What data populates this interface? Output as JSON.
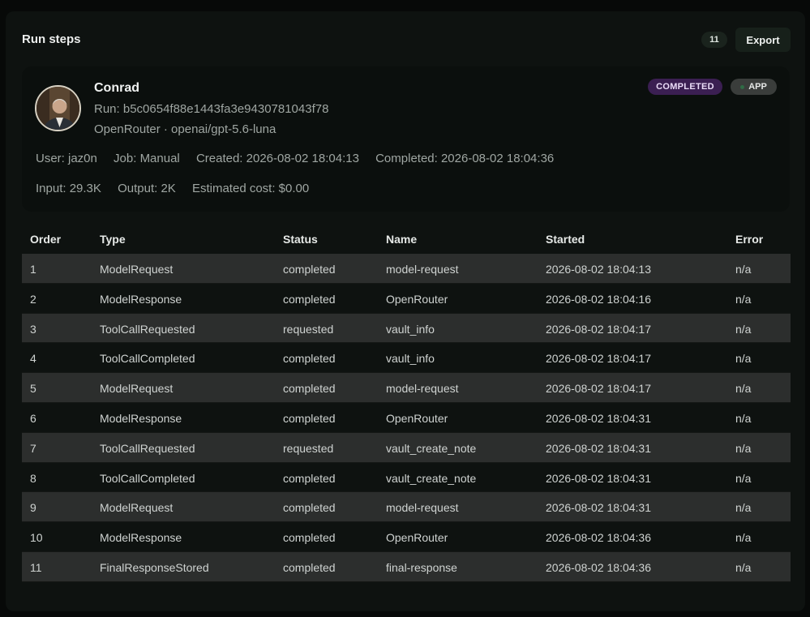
{
  "header": {
    "title": "Run steps",
    "count": "11",
    "export_label": "Export"
  },
  "run": {
    "user_name": "Conrad",
    "run_id": "Run: b5c0654f88e1443fa3e9430781043f78",
    "model": "OpenRouter · openai/gpt-5.6-luna",
    "status": "COMPLETED",
    "source": "APP",
    "meta1": [
      "User: jaz0n",
      "Job: Manual",
      "Created: 2026-08-02 18:04:13",
      "Completed: 2026-08-02 18:04:36"
    ],
    "meta2": [
      "Input: 29.3K",
      "Output: 2K",
      "Estimated cost: $0.00"
    ]
  },
  "table": {
    "columns": [
      "Order",
      "Type",
      "Status",
      "Name",
      "Started",
      "Error"
    ],
    "rows": [
      [
        "1",
        "ModelRequest",
        "completed",
        "model-request",
        "2026-08-02 18:04:13",
        "n/a"
      ],
      [
        "2",
        "ModelResponse",
        "completed",
        "OpenRouter",
        "2026-08-02 18:04:16",
        "n/a"
      ],
      [
        "3",
        "ToolCallRequested",
        "requested",
        "vault_info",
        "2026-08-02 18:04:17",
        "n/a"
      ],
      [
        "4",
        "ToolCallCompleted",
        "completed",
        "vault_info",
        "2026-08-02 18:04:17",
        "n/a"
      ],
      [
        "5",
        "ModelRequest",
        "completed",
        "model-request",
        "2026-08-02 18:04:17",
        "n/a"
      ],
      [
        "6",
        "ModelResponse",
        "completed",
        "OpenRouter",
        "2026-08-02 18:04:31",
        "n/a"
      ],
      [
        "7",
        "ToolCallRequested",
        "requested",
        "vault_create_note",
        "2026-08-02 18:04:31",
        "n/a"
      ],
      [
        "8",
        "ToolCallCompleted",
        "completed",
        "vault_create_note",
        "2026-08-02 18:04:31",
        "n/a"
      ],
      [
        "9",
        "ModelRequest",
        "completed",
        "model-request",
        "2026-08-02 18:04:31",
        "n/a"
      ],
      [
        "10",
        "ModelResponse",
        "completed",
        "OpenRouter",
        "2026-08-02 18:04:36",
        "n/a"
      ],
      [
        "11",
        "FinalResponseStored",
        "completed",
        "final-response",
        "2026-08-02 18:04:36",
        "n/a"
      ]
    ]
  }
}
